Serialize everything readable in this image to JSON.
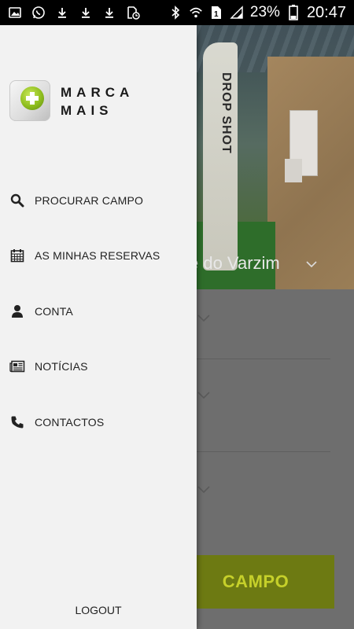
{
  "status_bar": {
    "left_icons": [
      "gallery-icon",
      "whatsapp-icon",
      "download-icon",
      "download-icon",
      "download-icon",
      "clock-file-icon"
    ],
    "right_icons": [
      "bluetooth-icon",
      "wifi-icon",
      "sim-icon",
      "signal-icon"
    ],
    "sim_number": "1",
    "battery_percent": "23%",
    "time": "20:47"
  },
  "drawer": {
    "brand_line1": "MARCA",
    "brand_line2": "MAIS",
    "menu": [
      {
        "label": "PROCURAR CAMPO",
        "icon": "search-icon"
      },
      {
        "label": "AS MINHAS RESERVAS",
        "icon": "calendar-icon"
      },
      {
        "label": "CONTA",
        "icon": "user-icon"
      },
      {
        "label": "NOTÍCIAS",
        "icon": "newspaper-icon"
      },
      {
        "label": "CONTACTOS",
        "icon": "phone-icon"
      }
    ],
    "logout_label": "LOGOUT"
  },
  "background": {
    "hero_title": "e do Varzim",
    "banner_text": "DROP SHOT",
    "cta_label": "CAMPO"
  },
  "colors": {
    "accent": "#c6d02a",
    "drawer_bg": "#f2f2f2",
    "cta_bg": "#6d7a12"
  }
}
